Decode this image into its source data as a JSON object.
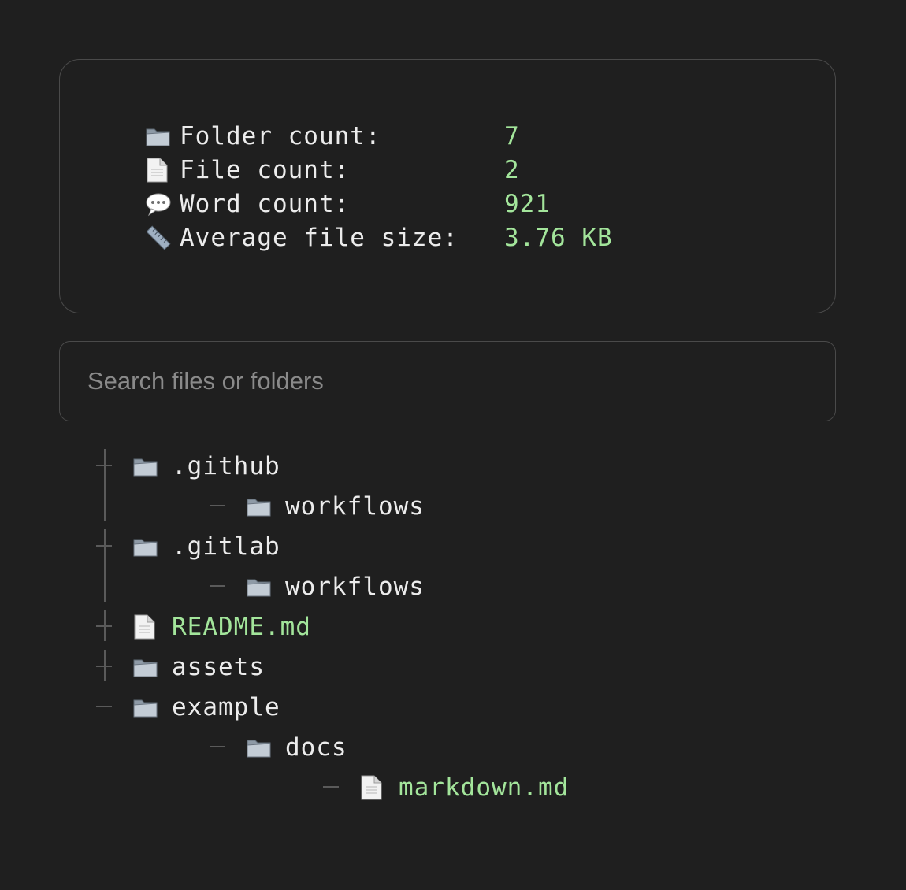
{
  "stats": [
    {
      "icon": "folder-icon",
      "label": "Folder count:",
      "value": "7"
    },
    {
      "icon": "file-icon",
      "label": "File count:",
      "value": "2"
    },
    {
      "icon": "speech-bubble-icon",
      "label": "Word count:",
      "value": "921"
    },
    {
      "icon": "ruler-icon",
      "label": "Average file size:",
      "value": "3.76 KB"
    }
  ],
  "search": {
    "placeholder": "Search files or folders",
    "value": ""
  },
  "tree": [
    {
      "name": ".github",
      "type": "folder",
      "depth": 0
    },
    {
      "name": "workflows",
      "type": "folder",
      "depth": 1
    },
    {
      "name": ".gitlab",
      "type": "folder",
      "depth": 0
    },
    {
      "name": "workflows",
      "type": "folder",
      "depth": 1
    },
    {
      "name": "README.md",
      "type": "file",
      "depth": 0
    },
    {
      "name": "assets",
      "type": "folder",
      "depth": 0
    },
    {
      "name": "example",
      "type": "folder",
      "depth": 0
    },
    {
      "name": "docs",
      "type": "folder",
      "depth": 1
    },
    {
      "name": "markdown.md",
      "type": "file",
      "depth": 2
    }
  ],
  "colors": {
    "background": "#1f1f1f",
    "file_accent": "#a3e59b",
    "border": "#4a4a4a"
  }
}
